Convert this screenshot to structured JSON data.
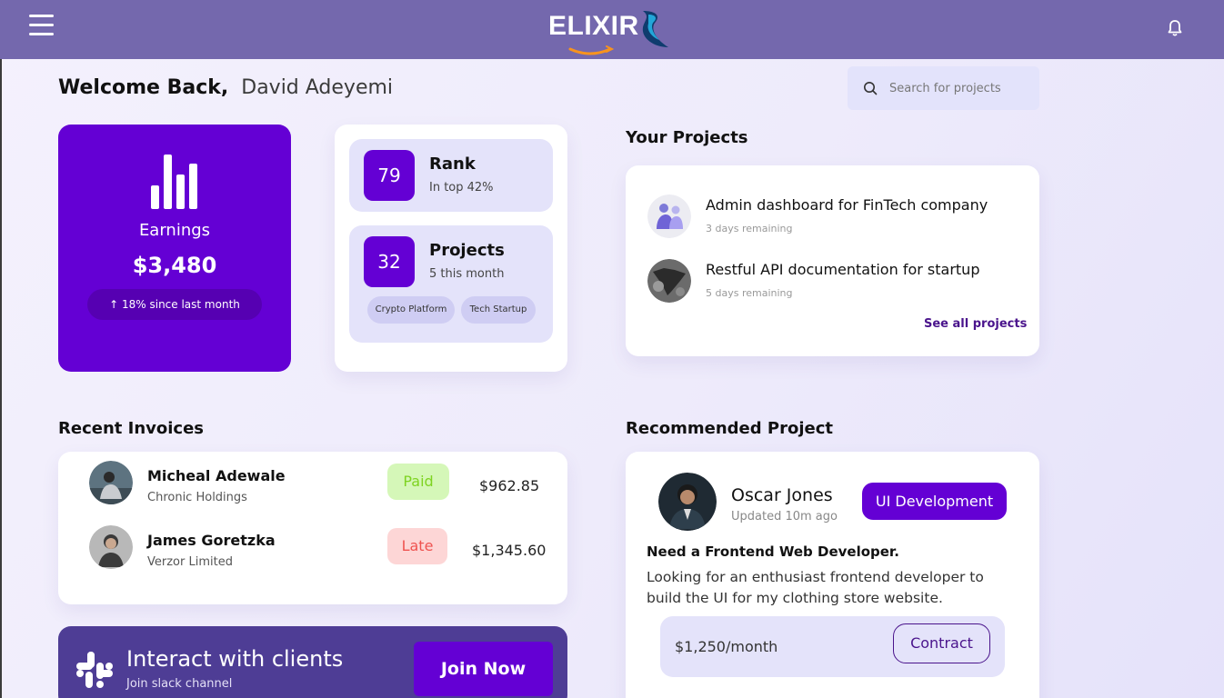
{
  "header": {
    "logo_text": "ELIXIR",
    "menu_icon": "hamburger-menu-icon",
    "notification_icon": "bell-icon"
  },
  "welcome": {
    "greeting": "Welcome Back,",
    "user_name": "David Adeyemi"
  },
  "search": {
    "placeholder": "Search for projects"
  },
  "earnings": {
    "label": "Earnings",
    "value": "$3,480",
    "change": "↑ 18% since last month"
  },
  "stats": {
    "rank": {
      "number": "79",
      "title": "Rank",
      "subtitle": "In top 42%"
    },
    "projects": {
      "number": "32",
      "title": "Projects",
      "subtitle": "5 this month",
      "tags": [
        "Crypto Platform",
        "Tech Startup"
      ]
    }
  },
  "your_projects": {
    "title": "Your Projects",
    "items": [
      {
        "title": "Admin dashboard for FinTech company",
        "subtitle": "3 days remaining"
      },
      {
        "title": "Restful API documentation for startup",
        "subtitle": "5 days remaining"
      }
    ],
    "see_all": "See all projects"
  },
  "invoices": {
    "title": "Recent Invoices",
    "rows": [
      {
        "name": "Micheal Adewale",
        "company": "Chronic Holdings",
        "status": "Paid",
        "amount": "$962.85"
      },
      {
        "name": "James Goretzka",
        "company": "Verzor Limited",
        "status": "Late",
        "amount": "$1,345.60"
      }
    ]
  },
  "slack": {
    "title": "Interact with clients",
    "subtitle": "Join slack channel",
    "button": "Join Now"
  },
  "recommended": {
    "title": "Recommended Project",
    "name": "Oscar Jones",
    "updated": "Updated 10m ago",
    "category": "UI Development",
    "headline": "Need a Frontend Web Developer.",
    "description": "Looking for an enthusiast frontend developer to build the UI for my clothing store website.",
    "price": "$1,250/month",
    "type_button": "Contract"
  },
  "colors": {
    "header": "#7468ad",
    "accent": "#6400d4",
    "paid": "#7ed321",
    "late": "#ef5350"
  }
}
